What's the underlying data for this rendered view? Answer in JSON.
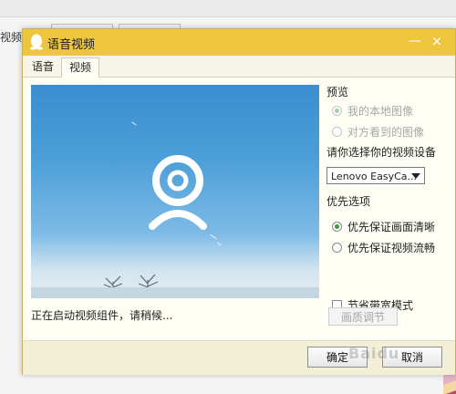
{
  "background_app": {
    "label": "视频:"
  },
  "dialog": {
    "title": "语音视频",
    "minimize_glyph": "—",
    "close_glyph": "×"
  },
  "tabs": [
    {
      "label": "语音",
      "active": false
    },
    {
      "label": "视频",
      "active": true
    }
  ],
  "preview": {
    "status_text": "正在启动视频组件，请稍候..."
  },
  "preview_section": {
    "label": "预览",
    "options": [
      {
        "label": "我的本地图像",
        "checked": true,
        "disabled": true
      },
      {
        "label": "对方看到的图像",
        "checked": false,
        "disabled": true
      }
    ]
  },
  "device_section": {
    "label": "请你选择你的视频设备",
    "selected": "Lenovo EasyCa..."
  },
  "priority_section": {
    "label": "优先选项",
    "options": [
      {
        "label": "优先保证画面清晰",
        "checked": true
      },
      {
        "label": "优先保证视频流畅",
        "checked": false
      }
    ]
  },
  "bandwidth_checkbox": {
    "label": "节省带宽模式",
    "checked": false
  },
  "quality_button": {
    "label": "画质调节",
    "disabled": true
  },
  "footer": {
    "ok_label": "确定",
    "cancel_label": "取消"
  },
  "watermark": "Baidu",
  "colors": {
    "titlebar": "#eec63d",
    "accent_green": "#3a9b3a",
    "sky": "#4c9fd8"
  },
  "icons": [
    "qq-penguin-icon",
    "webcam-icon",
    "minimize-icon",
    "close-icon",
    "dropdown-arrow-icon"
  ]
}
